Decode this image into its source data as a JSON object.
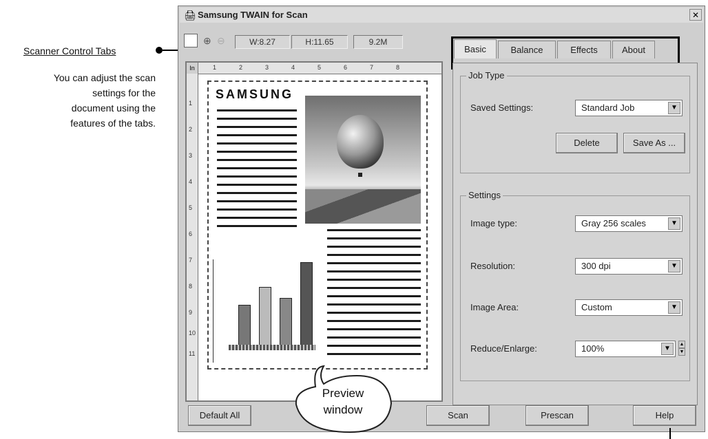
{
  "annotation": {
    "title": "Scanner Control Tabs",
    "description_lines": [
      "You can adjust the scan",
      "settings for the",
      "document using the",
      "features of the tabs."
    ]
  },
  "window": {
    "title": "Samsung TWAIN for Scan",
    "close": "✕"
  },
  "toolbar": {
    "width_readout": "W:8.27",
    "height_readout": "H:11.65",
    "size_readout": "9.2M"
  },
  "ruler": {
    "corner": "In",
    "h_ticks": [
      "1",
      "2",
      "3",
      "4",
      "5",
      "6",
      "7",
      "8"
    ],
    "v_ticks": [
      "1",
      "2",
      "3",
      "4",
      "5",
      "6",
      "7",
      "8",
      "9",
      "10",
      "11"
    ]
  },
  "preview": {
    "logo": "SAMSUNG"
  },
  "callout": {
    "line1": "Preview",
    "line2": "window"
  },
  "tabs": [
    {
      "label": "Basic",
      "active": true
    },
    {
      "label": "Balance",
      "active": false
    },
    {
      "label": "Effects",
      "active": false
    },
    {
      "label": "About",
      "active": false
    }
  ],
  "job_type": {
    "title": "Job Type",
    "saved_settings_label": "Saved Settings:",
    "saved_settings_value": "Standard Job",
    "delete_label": "Delete",
    "save_as_label": "Save As ..."
  },
  "settings": {
    "title": "Settings",
    "image_type_label": "Image type:",
    "image_type_value": "Gray 256 scales",
    "resolution_label": "Resolution:",
    "resolution_value": "300 dpi",
    "image_area_label": "Image Area:",
    "image_area_value": "Custom",
    "reduce_label": "Reduce/Enlarge:",
    "reduce_value": "100%"
  },
  "buttons": {
    "default_all": "Default All",
    "scan": "Scan",
    "prescan": "Prescan",
    "help": "Help"
  }
}
